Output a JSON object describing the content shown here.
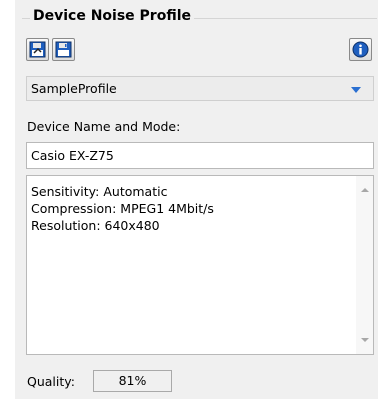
{
  "group": {
    "title": "Device Noise Profile"
  },
  "toolbar": {
    "open_icon": "save-as-disk-icon",
    "save_icon": "save-disk-icon",
    "info_icon": "info-icon"
  },
  "profile": {
    "selected": "SampleProfile"
  },
  "device": {
    "label": "Device Name and Mode:",
    "value": "Casio EX-Z75"
  },
  "details": {
    "lines": [
      "Sensitivity: Automatic",
      "Compression: MPEG1 4Mbit/s",
      "Resolution: 640x480"
    ]
  },
  "quality": {
    "label": "Quality:",
    "value": "81%"
  },
  "colors": {
    "accent": "#2a6fd1",
    "panel_bg": "#f0f0f0",
    "icon_blue": "#1f5fbf"
  }
}
